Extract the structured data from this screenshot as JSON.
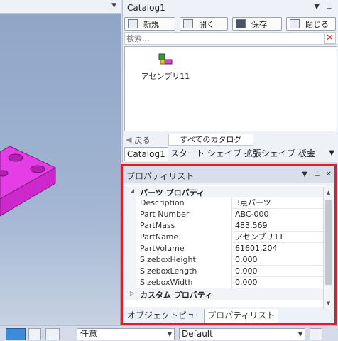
{
  "catalog": {
    "title": "Catalog1",
    "toolbar": {
      "new_label": "新規",
      "open_label": "開く",
      "save_label": "保存",
      "close_label": "閉じる"
    },
    "search_placeholder": "検索...",
    "items": [
      {
        "label": "アセンブリ11",
        "icon": "assembly-icon"
      }
    ],
    "back_label": "戻る",
    "all_catalogs_label": "すべてのカタログ",
    "tabs": [
      "Catalog1",
      "スタート",
      "シェイプ",
      "拡張シェイプ",
      "板金"
    ]
  },
  "properties": {
    "title": "プロパティリスト",
    "group_parts": "パーツ プロパティ",
    "rows": [
      {
        "key": "Description",
        "value": "3点パーツ"
      },
      {
        "key": "Part Number",
        "value": "ABC-000"
      },
      {
        "key": "PartMass",
        "value": "483.569"
      },
      {
        "key": "PartName",
        "value": "アセンブリ11"
      },
      {
        "key": "PartVolume",
        "value": "61601.204"
      },
      {
        "key": "SizeboxHeight",
        "value": "0.000"
      },
      {
        "key": "SizeboxLength",
        "value": "0.000"
      },
      {
        "key": "SizeboxWidth",
        "value": "0.000"
      }
    ],
    "group_custom": "カスタム プロパティ",
    "tabs": [
      "オブジェクトビューア",
      "プロパティリスト"
    ]
  },
  "statusbar": {
    "mode_value": "任意",
    "style_value": "Default"
  },
  "colors": {
    "highlight": "#e01e2a",
    "part": "#e63ee6"
  }
}
